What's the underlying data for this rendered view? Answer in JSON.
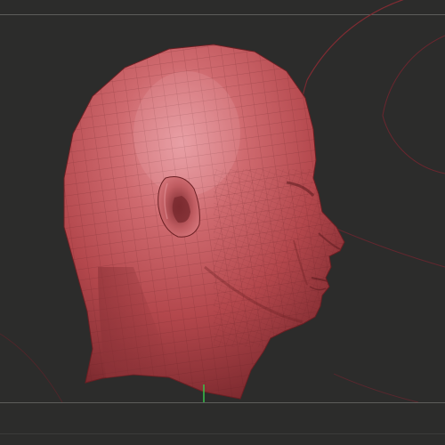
{
  "viewport": {
    "background_color": "#2c2c2b",
    "guide_line_color": "#5d5d5b",
    "model_color": "#b84a4b",
    "model_highlight_color": "#e59aa0",
    "model_shadow_color": "#6a1f23",
    "gizmo_ring_color": "#8a2b33",
    "axis_marker_color": "#36c24a"
  },
  "model": {
    "subject": "sculpted-human-head-side-profile",
    "wireframe_overlay": true
  }
}
